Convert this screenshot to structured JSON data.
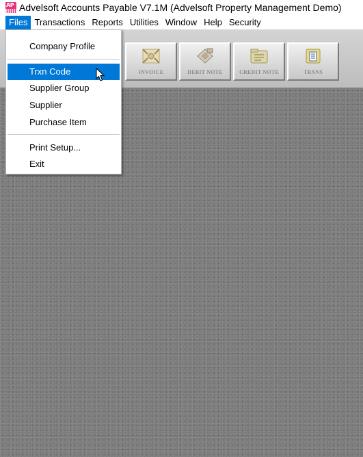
{
  "window": {
    "title": "Advelsoft Accounts Payable V7.1M (Advelsoft Property Management Demo)",
    "app_icon_text": "AP"
  },
  "menubar": {
    "items": [
      "Files",
      "Transactions",
      "Reports",
      "Utilities",
      "Window",
      "Help",
      "Security"
    ],
    "active": "Files"
  },
  "files_menu": {
    "company_profile": "Company Profile",
    "trxn_code": "Trxn Code",
    "supplier_group": "Supplier Group",
    "supplier": "Supplier",
    "purchase_item": "Purchase Item",
    "print_setup": "Print Setup...",
    "exit": "Exit",
    "highlighted": "Trxn Code"
  },
  "toolbar": {
    "buttons": [
      {
        "label": "INVOICE",
        "icon": "invoice-icon"
      },
      {
        "label": "DEBIT NOTE",
        "icon": "debit-note-icon"
      },
      {
        "label": "CREDIT NOTE",
        "icon": "credit-note-icon"
      },
      {
        "label": "TRXNS",
        "icon": "transactions-icon"
      }
    ]
  },
  "colors": {
    "menu_highlight": "#0078d7",
    "workspace": "#7b7b7b",
    "app_icon": "#e8327a"
  }
}
